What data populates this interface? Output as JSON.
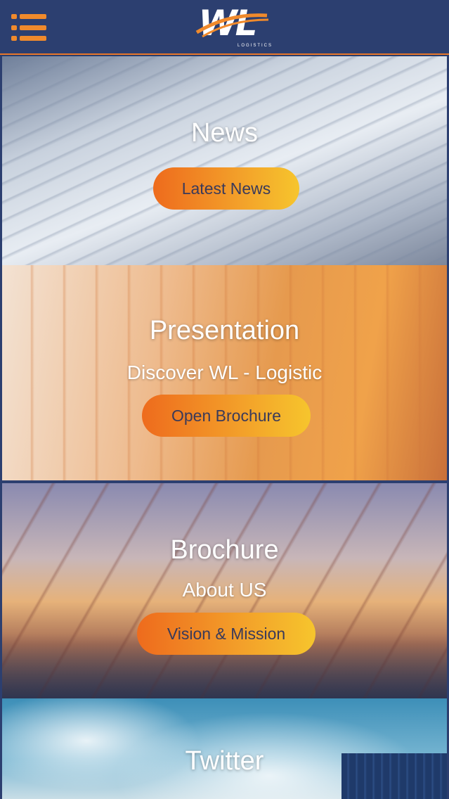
{
  "header": {
    "menu_icon": "hamburger-menu-icon",
    "logo_text": "WL",
    "logo_sub": "LOGISTICS"
  },
  "sections": [
    {
      "title": "News",
      "subtitle": "",
      "button": "Latest News"
    },
    {
      "title": "Presentation",
      "subtitle": "Discover WL - Logistic",
      "button": "Open Brochure"
    },
    {
      "title": "Brochure",
      "subtitle": "About US",
      "button": "Vision & Mission"
    },
    {
      "title": "Twitter",
      "subtitle": "",
      "button": ""
    }
  ],
  "colors": {
    "header": "#2c3f70",
    "accent_orange": "#ee6b1d",
    "accent_yellow": "#f6c52d"
  }
}
